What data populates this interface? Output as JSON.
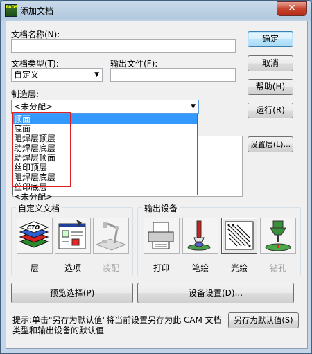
{
  "window": {
    "title": "添加文档",
    "app_icon_text": "PADS",
    "close_symbol": "✕"
  },
  "fields": {
    "doc_name_label": "文档名称(N):",
    "doc_name_value": "",
    "doc_type_label": "文档类型(T):",
    "doc_type_value": "自定义",
    "output_file_label": "输出文件(F):",
    "output_file_value": "",
    "layer_label": "制造层:",
    "layer_value": "<未分配>"
  },
  "layer_dropdown": {
    "options": [
      "顶面",
      "底面",
      "阻焊层顶层",
      "助焊层底层",
      "助焊层顶面",
      "丝印顶层",
      "阻焊层底层",
      "丝印底层",
      "<未分配>"
    ],
    "selected": "顶面"
  },
  "buttons": {
    "ok": "确定",
    "cancel": "取消",
    "help": "帮助(H)",
    "run": "运行(R)",
    "set_layer": "设置层(L)...",
    "preview": "预览选择(P)",
    "device_setup": "设备设置(D)...",
    "save_default": "另存为默认值(S)"
  },
  "custom_docs": {
    "title": "自定义文档",
    "tiles": [
      {
        "label": "层",
        "icon": "layers-icon",
        "enabled": true
      },
      {
        "label": "选项",
        "icon": "options-icon",
        "enabled": true
      },
      {
        "label": "装配",
        "icon": "assembly-icon",
        "enabled": false
      }
    ]
  },
  "output_devices": {
    "title": "输出设备",
    "tiles": [
      {
        "label": "打印",
        "icon": "printer-icon",
        "enabled": true
      },
      {
        "label": "笔绘",
        "icon": "pen-plotter-icon",
        "enabled": true
      },
      {
        "label": "光绘",
        "icon": "photoplotter-icon",
        "enabled": true,
        "selected": true
      },
      {
        "label": "钻孔",
        "icon": "drill-icon",
        "enabled": false
      }
    ]
  },
  "hint": "提示:单击\"另存为默认值\"将当前设置另存为此 CAM 文档类型和输出设备的默认值",
  "colors": {
    "selection": "#3399ff",
    "highlight_box": "#e02020"
  }
}
